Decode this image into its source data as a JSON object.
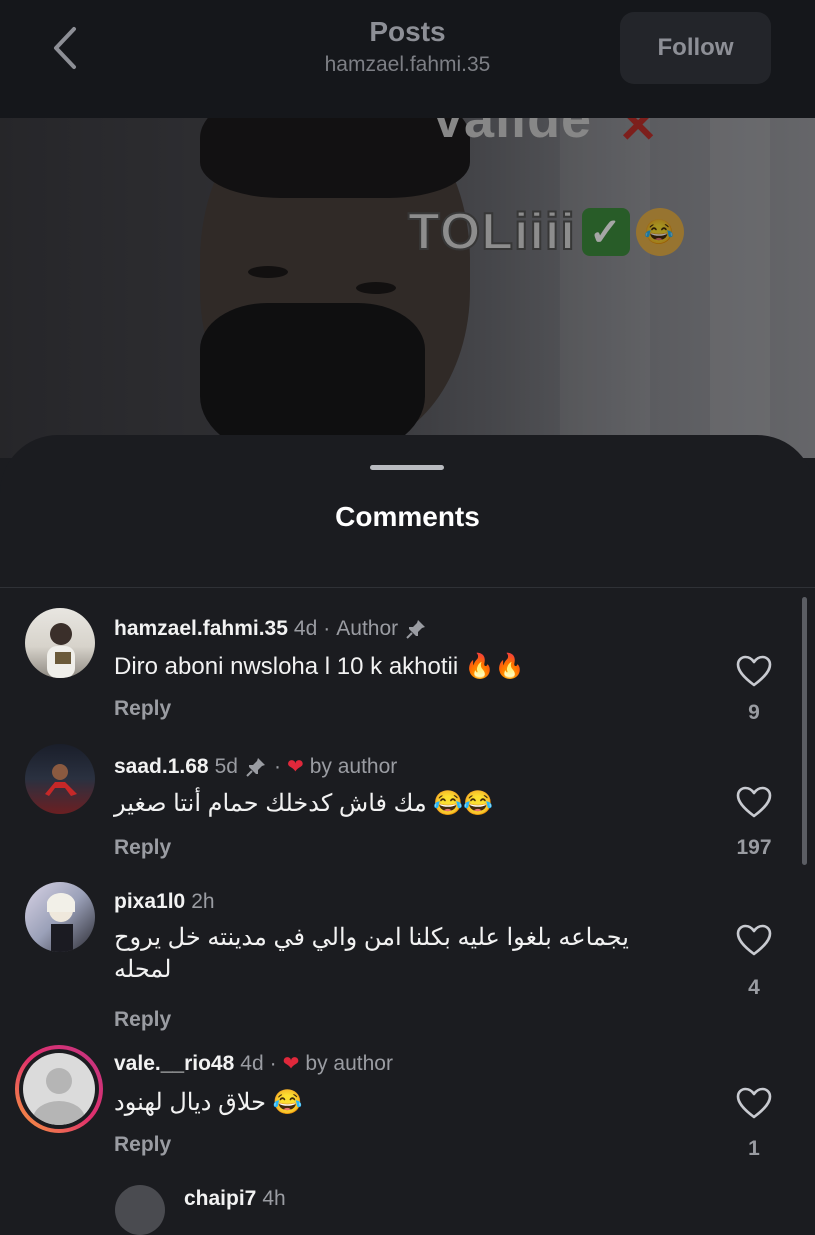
{
  "header": {
    "title": "Posts",
    "username": "hamzael.fahmi.35",
    "follow_label": "Follow"
  },
  "media": {
    "overlay_top_text": "Valide",
    "overlay_text": "TOLiiii"
  },
  "sheet": {
    "title": "Comments"
  },
  "comments": [
    {
      "username": "hamzael.fahmi.35",
      "time": "4d",
      "tag": "Author",
      "text": "Diro aboni nwsloha l 10 k akhotii 🔥🔥",
      "reply": "Reply",
      "likes": "9"
    },
    {
      "username": "saad.1.68",
      "time": "5d",
      "tag": "by author",
      "text": "مك فاش كدخلك حمام أنتا صغير 😂😂",
      "reply": "Reply",
      "likes": "197"
    },
    {
      "username": "pixa1l0",
      "time": "2h",
      "text": "يجماعه بلغوا عليه بكلنا امن والي في مدينته خل يروح لمحله",
      "reply": "Reply",
      "likes": "4"
    },
    {
      "username": "vale.__rio48",
      "time": "4d",
      "tag": "by author",
      "text": "حلاق ديال لهنود 😂",
      "reply": "Reply",
      "likes": "1"
    }
  ],
  "partial_next_username": "chaipi7",
  "partial_next_time": "4h",
  "colors": {
    "background": "#1b1c20",
    "topbar": "#15171b",
    "accent_heart": "#e0283b",
    "story_ring": "#c13584"
  }
}
